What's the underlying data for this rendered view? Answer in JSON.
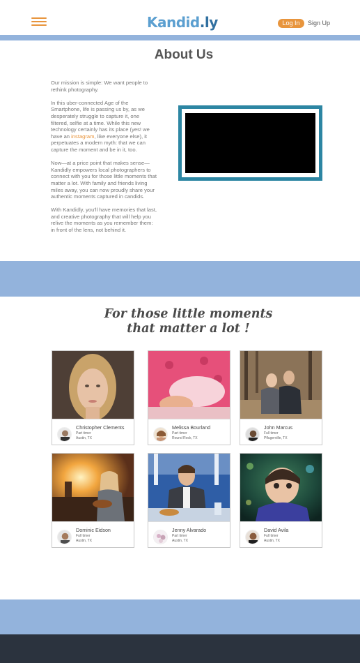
{
  "header": {
    "menu_icon": "hamburger-menu-icon",
    "logo_part1": "Kandid",
    "logo_part2": ".ly",
    "login_label": "Log In",
    "signup_label": "Sign Up"
  },
  "about": {
    "title": "About Us",
    "paragraphs": {
      "p1": "Our mission is simple: We want people to rethink photography.",
      "p2_before": "In this uber-connected Age of the Smartphone, life is passing us by, as we desperately struggle to capture it, one filtered, selfie at a time. While this new technology certainly has its place (yes! we  have an ",
      "p2_link": "instagram",
      "p2_after": ", like everyone else), it perpetuates a modern myth: that we can capture the moment and be in it, too.",
      "p3": "Now—at a price point that makes sense—Kandidly empowers local photographers to connect with you for those little moments that matter a lot. With family and friends living miles away, you can now proudly share your authentic moments captured in candids.",
      "p4": "With Kandidly, you'll have memories that last, and creative photography that will help you relive the moments as you remember them: in front of the lens, not behind it."
    }
  },
  "tagline": {
    "line1": "For those little moments",
    "line2": "that matter a lot !"
  },
  "photographers": [
    {
      "name": "Christopher Clements",
      "role": "Part timer",
      "location": "Austin, TX"
    },
    {
      "name": "Melissa Bourland",
      "role": "Part timer",
      "location": "Round Rock, TX"
    },
    {
      "name": "John Marcus",
      "role": "Full timer",
      "location": "Pflugerville, TX"
    },
    {
      "name": "Dominic Eidson",
      "role": "Full timer",
      "location": "Austin, TX"
    },
    {
      "name": "Jenny Alvarado",
      "role": "Part timer",
      "location": "Austin, TX"
    },
    {
      "name": "David Avila",
      "role": "Full timer",
      "location": "Austin, TX"
    }
  ],
  "colors": {
    "accent_orange": "#e8953d",
    "band_blue": "#93b3dc",
    "video_frame_teal": "#2d86a3",
    "footer_dark": "#2b333e"
  }
}
